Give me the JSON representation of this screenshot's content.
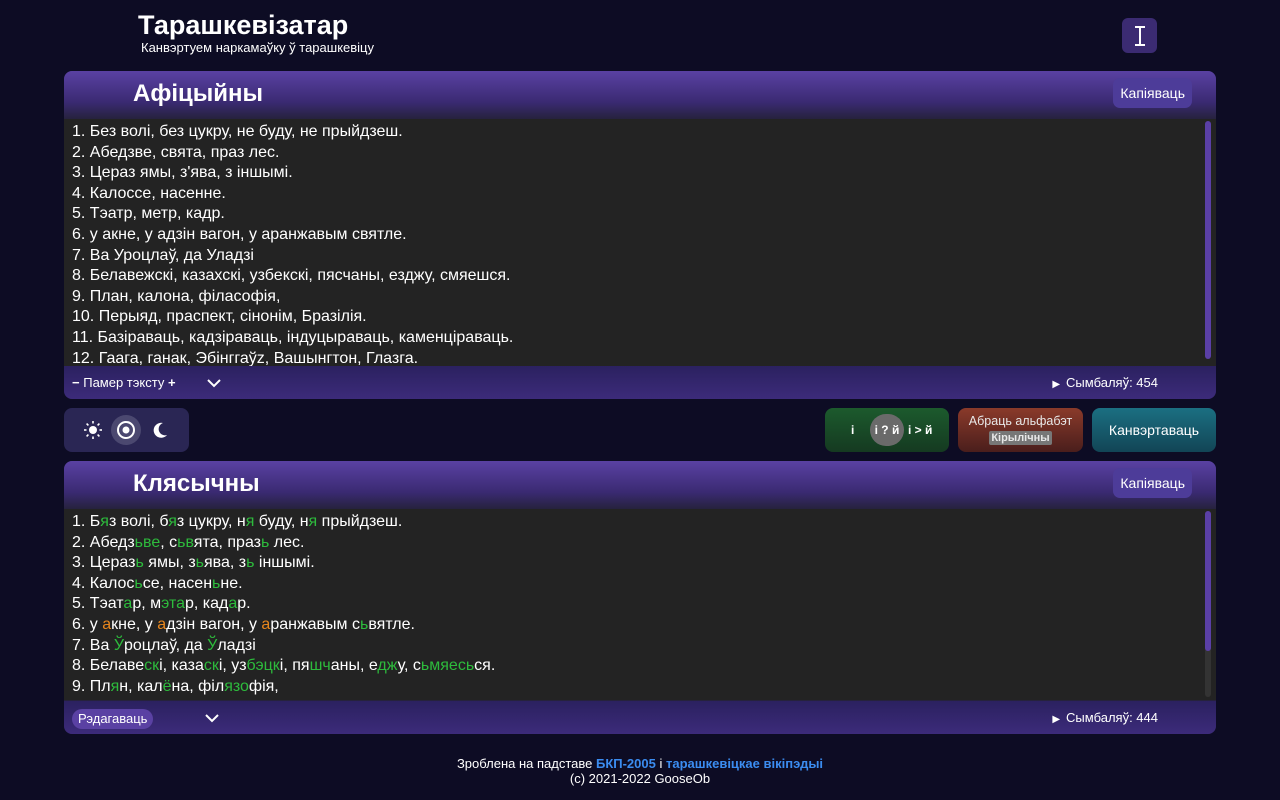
{
  "app": {
    "title": "Тарашкевізатар",
    "subtitle": "Канвэртуем наркамаўку ў тарашкевіцу",
    "theme_toggle_label": "I"
  },
  "source_panel": {
    "title": "Афіцыйны",
    "copy_label": "Капіяваць",
    "lines": [
      "1. Без волі, без цукру, не буду, не прыйдзеш.",
      "2. Абедзве, свята, праз лес.",
      "3. Цераз ямы, з'ява, з іншымі.",
      "4. Калоссе, насенне.",
      "5. Тэатр, метр, кадр.",
      "6. у акне, у адзін вагон, у аранжавым святле.",
      "7. Ва Уроцлаў, да Уладзі",
      "8. Белавежскі, казахскі, узбекскі, пясчаны, езджу, смяешся.",
      "9. План, калона, філасофія,",
      "10. Перыяд, праспект, сінонім, Бразілія.",
      "11. Базіраваць, кадзіраваць, індуцыраваць, каменціраваць.",
      "12. Гаага, ганак, Эбінггаўz, Вашынгтон, Глазга."
    ],
    "font_size_minus": "−",
    "font_size_label": "Памер тэксту",
    "font_size_plus": "+",
    "char_count": "Сымбаляў: 454"
  },
  "controls": {
    "mode_options": [
      "sun-icon",
      "circle-dot-icon",
      "moon-icon"
    ],
    "letter_left": "і",
    "letter_mid": "і ? й",
    "letter_right": "і > й",
    "alphabet_label": "Абраць альфабэт",
    "alphabet_value": "Кірылічны",
    "convert_label": "Канвэртаваць"
  },
  "result_panel": {
    "title": "Клясычны",
    "copy_label": "Капіяваць",
    "lines": [
      [
        [
          "1. Б",
          ""
        ],
        [
          "я",
          "g"
        ],
        [
          "з волі, б",
          ""
        ],
        [
          "я",
          "g"
        ],
        [
          "з цукру, н",
          ""
        ],
        [
          "я",
          "g"
        ],
        [
          " буду, н",
          ""
        ],
        [
          "я",
          "g"
        ],
        [
          " прыйдзеш.",
          ""
        ]
      ],
      [
        [
          "2. Абедз",
          ""
        ],
        [
          "ьве",
          "g"
        ],
        [
          ", с",
          ""
        ],
        [
          "ьв",
          "g"
        ],
        [
          "ята, праз",
          ""
        ],
        [
          "ь",
          "g"
        ],
        [
          " лес.",
          ""
        ]
      ],
      [
        [
          "3. Цераз",
          ""
        ],
        [
          "ь",
          "g"
        ],
        [
          " ямы, з",
          ""
        ],
        [
          "ь",
          "g"
        ],
        [
          "ява, з",
          ""
        ],
        [
          "ь",
          "g"
        ],
        [
          " іншымі.",
          ""
        ]
      ],
      [
        [
          "4. Калос",
          ""
        ],
        [
          "ь",
          "g"
        ],
        [
          "се, насен",
          ""
        ],
        [
          "ь",
          "g"
        ],
        [
          "не.",
          ""
        ]
      ],
      [
        [
          "5. Тэат",
          ""
        ],
        [
          "а",
          "g"
        ],
        [
          "р, м",
          ""
        ],
        [
          "эта",
          "g"
        ],
        [
          "р, кад",
          ""
        ],
        [
          "а",
          "g"
        ],
        [
          "р.",
          ""
        ]
      ],
      [
        [
          "6. у ",
          ""
        ],
        [
          "а",
          "o"
        ],
        [
          "кне, у ",
          ""
        ],
        [
          "а",
          "o"
        ],
        [
          "дзін вагон, у ",
          ""
        ],
        [
          "а",
          "o"
        ],
        [
          "ранжавым с",
          ""
        ],
        [
          "ь",
          "g"
        ],
        [
          "вятле.",
          ""
        ]
      ],
      [
        [
          "7. Ва ",
          ""
        ],
        [
          "Ў",
          "g"
        ],
        [
          "роцлаў, да ",
          ""
        ],
        [
          "Ў",
          "g"
        ],
        [
          "ладзі",
          ""
        ]
      ],
      [
        [
          "8. Белаве",
          ""
        ],
        [
          "ск",
          "g"
        ],
        [
          "і, каза",
          ""
        ],
        [
          "ск",
          "g"
        ],
        [
          "і, уз",
          ""
        ],
        [
          "бэцк",
          "g"
        ],
        [
          "і, пя",
          ""
        ],
        [
          "шч",
          "g"
        ],
        [
          "аны, е",
          ""
        ],
        [
          "дж",
          "g"
        ],
        [
          "у, с",
          ""
        ],
        [
          "ьмяесь",
          "g"
        ],
        [
          "ся.",
          ""
        ]
      ],
      [
        [
          "9. Пл",
          ""
        ],
        [
          "я",
          "g"
        ],
        [
          "н, кал",
          ""
        ],
        [
          "ё",
          "g"
        ],
        [
          "на, філ",
          ""
        ],
        [
          "язо",
          "g"
        ],
        [
          "фія,",
          ""
        ]
      ]
    ],
    "edit_label": "Рэдагаваць",
    "char_count": "Сымбаляў: 444"
  },
  "footer": {
    "prefix": "Зроблена на падставе ",
    "link1": "БКП-2005",
    "middle": " і ",
    "link2": "тарашкевіцкае вікіпэдыі",
    "copyright": "(c) 2021-2022 GooseOb"
  },
  "colors": {
    "background": "#0d0c24",
    "accent": "#5a41a3",
    "highlight_green": "#2dbb3c",
    "highlight_orange": "#e8861c",
    "link": "#3b8cf0"
  }
}
